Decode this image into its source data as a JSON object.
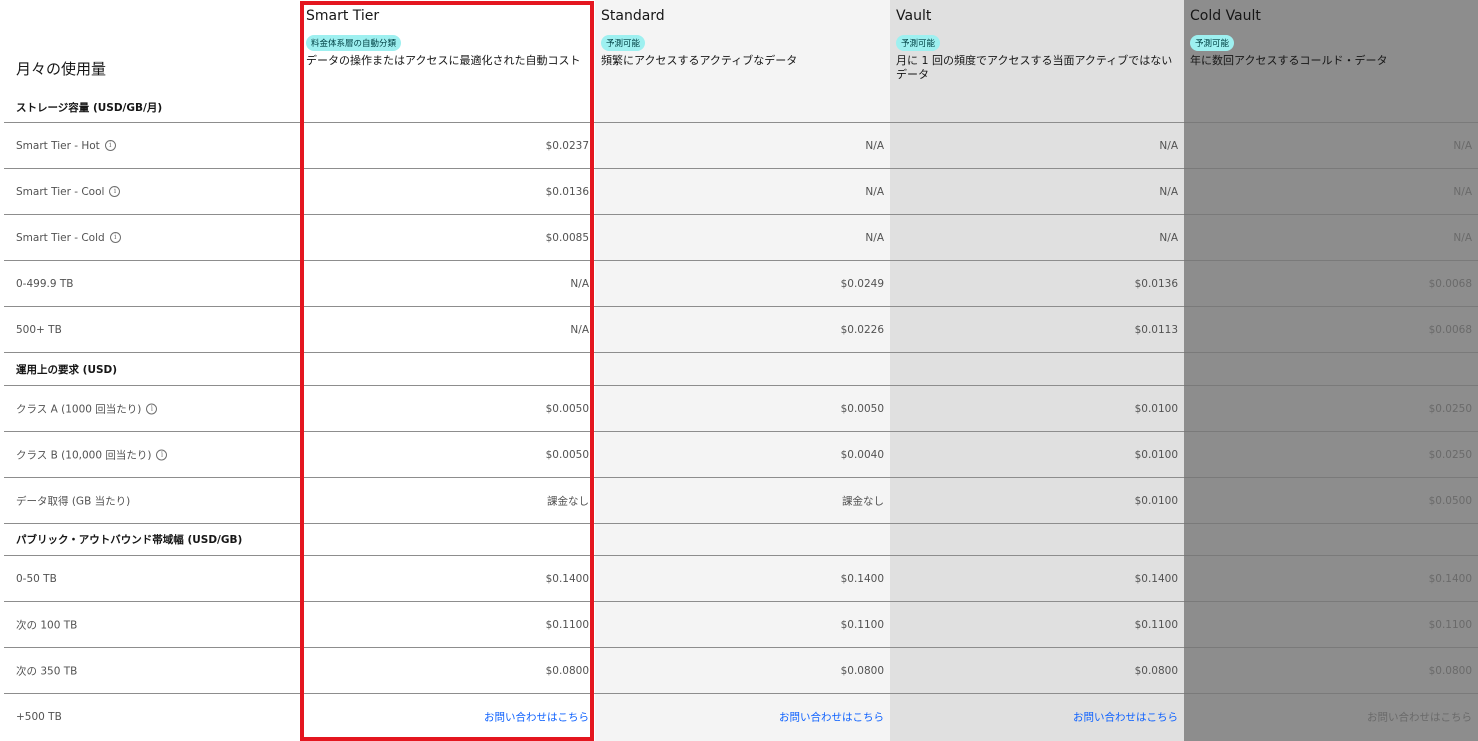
{
  "header": {
    "monthly_usage": "月々の使用量",
    "columns": [
      {
        "title": "Smart Tier",
        "badge": "料金体系層の自動分類",
        "desc": "データの操作またはアクセスに最適化された自動コスト"
      },
      {
        "title": "Standard",
        "badge": "予測可能",
        "desc": "頻繁にアクセスするアクティブなデータ"
      },
      {
        "title": "Vault",
        "badge": "予測可能",
        "desc": "月に 1 回の頻度でアクセスする当面アクティブではないデータ"
      },
      {
        "title": "Cold Vault",
        "badge": "予測可能",
        "desc": "年に数回アクセスするコールド・データ"
      }
    ]
  },
  "sections": {
    "storage": "ストレージ容量 (USD/GB/月)",
    "operations": "運用上の要求 (USD)",
    "bandwidth": "パブリック・アウトバウンド帯域幅 (USD/GB)"
  },
  "rows": [
    {
      "label": "Smart Tier - Hot",
      "info": true,
      "values": [
        "$0.0237",
        "N/A",
        "N/A",
        "N/A"
      ]
    },
    {
      "label": "Smart Tier - Cool",
      "info": true,
      "values": [
        "$0.0136",
        "N/A",
        "N/A",
        "N/A"
      ]
    },
    {
      "label": "Smart Tier - Cold",
      "info": true,
      "values": [
        "$0.0085",
        "N/A",
        "N/A",
        "N/A"
      ]
    },
    {
      "label": "0-499.9 TB",
      "info": false,
      "values": [
        "N/A",
        "$0.0249",
        "$0.0136",
        "$0.0068"
      ]
    },
    {
      "label": "500+ TB",
      "info": false,
      "values": [
        "N/A",
        "$0.0226",
        "$0.0113",
        "$0.0068"
      ]
    },
    {
      "label": "クラス A (1000 回当たり)",
      "info": true,
      "values": [
        "$0.0050",
        "$0.0050",
        "$0.0100",
        "$0.0250"
      ]
    },
    {
      "label": "クラス B (10,000 回当たり)",
      "info": true,
      "values": [
        "$0.0050",
        "$0.0040",
        "$0.0100",
        "$0.0250"
      ]
    },
    {
      "label": "データ取得 (GB 当たり)",
      "info": false,
      "values": [
        "課金なし",
        "課金なし",
        "$0.0100",
        "$0.0500"
      ]
    },
    {
      "label": "0-50 TB",
      "info": false,
      "values": [
        "$0.1400",
        "$0.1400",
        "$0.1400",
        "$0.1400"
      ]
    },
    {
      "label": "次の 100 TB",
      "info": false,
      "values": [
        "$0.1100",
        "$0.1100",
        "$0.1100",
        "$0.1100"
      ]
    },
    {
      "label": "次の 350 TB",
      "info": false,
      "values": [
        "$0.0800",
        "$0.0800",
        "$0.0800",
        "$0.0800"
      ]
    },
    {
      "label": "+500 TB",
      "info": false,
      "values": [
        "お問い合わせはこちら",
        "お問い合わせはこちら",
        "お問い合わせはこちら",
        "お問い合わせはこちら"
      ]
    }
  ],
  "colors": {
    "highlight": "#e4161f",
    "badge": "#9ef0f0",
    "link": "#0f62fe"
  }
}
